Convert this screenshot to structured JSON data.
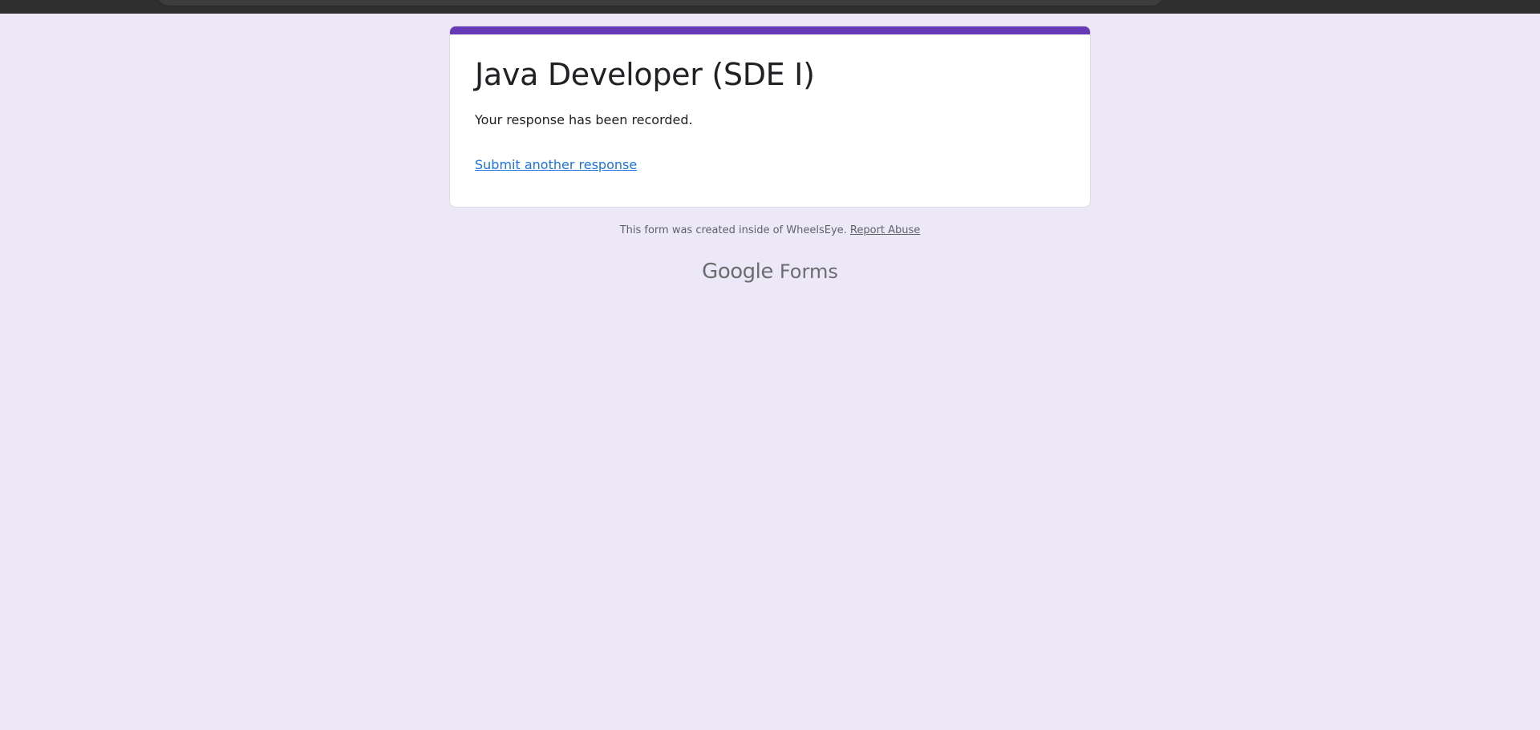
{
  "form": {
    "title": "Java Developer (SDE I)",
    "confirmation": "Your response has been recorded.",
    "submit_another": "Submit another response"
  },
  "footer": {
    "note": "This form was created inside of WheelsEye.",
    "report_abuse": "Report Abuse"
  },
  "brand": {
    "google": "Google",
    "product": "Forms"
  },
  "colors": {
    "accent": "#673ab7",
    "background": "#ede8f7",
    "link": "#1a73e8"
  }
}
